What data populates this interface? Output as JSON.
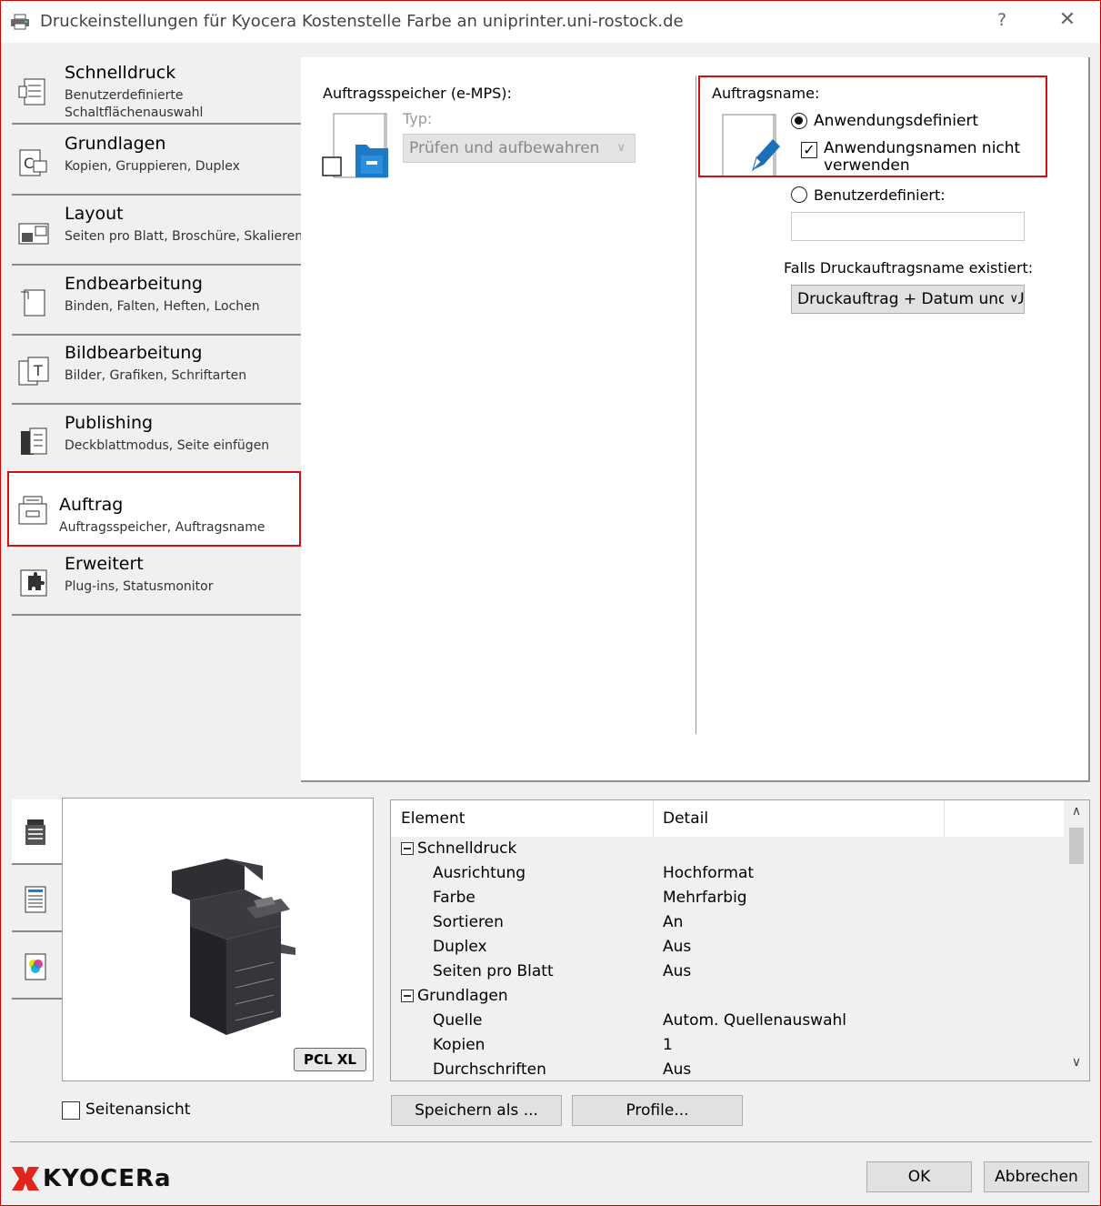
{
  "window": {
    "title": "Druckeinstellungen für Kyocera Kostenstelle Farbe an uniprinter.uni-rostock.de",
    "help": "?",
    "close": "✕"
  },
  "nav": {
    "items": [
      {
        "label": "Schnelldruck",
        "desc1": "Benutzerdefinierte",
        "desc2": "Schaltflächenauswahl"
      },
      {
        "label": "Grundlagen",
        "desc1": "Kopien, Gruppieren, Duplex",
        "desc2": ""
      },
      {
        "label": "Layout",
        "desc1": "Seiten pro Blatt, Broschüre, Skalieren",
        "desc2": ""
      },
      {
        "label": "Endbearbeitung",
        "desc1": "Binden, Falten, Heften, Lochen",
        "desc2": ""
      },
      {
        "label": "Bildbearbeitung",
        "desc1": "Bilder, Grafiken, Schriftarten",
        "desc2": ""
      },
      {
        "label": "Publishing",
        "desc1": "Deckblattmodus, Seite einfügen",
        "desc2": ""
      },
      {
        "label": "Auftrag",
        "desc1": "Auftragsspeicher, Auftragsname",
        "desc2": ""
      },
      {
        "label": "Erweitert",
        "desc1": "Plug-ins, Statusmonitor",
        "desc2": ""
      }
    ],
    "active_index": 6
  },
  "job_storage": {
    "label": "Auftragsspeicher (e-MPS):",
    "type_label": "Typ:",
    "type_value": "Prüfen und aufbewahren"
  },
  "job_name": {
    "label": "Auftragsname:",
    "opt_app_defined": "Anwendungsdefiniert",
    "opt_no_app_name_line1": "Anwendungsnamen nicht",
    "opt_no_app_name_line2": "verwenden",
    "opt_custom": "Benutzerdefiniert:",
    "custom_value": "",
    "exists_label": "Falls Druckauftragsname existiert:",
    "exists_value": "Druckauftrag + Datum und Uhrzeit"
  },
  "preview": {
    "badge": "PCL XL"
  },
  "summary": {
    "col_element": "Element",
    "col_detail": "Detail",
    "rows": [
      {
        "group": true,
        "element": "Schnelldruck",
        "detail": ""
      },
      {
        "group": false,
        "element": "Ausrichtung",
        "detail": "Hochformat"
      },
      {
        "group": false,
        "element": "Farbe",
        "detail": "Mehrfarbig"
      },
      {
        "group": false,
        "element": "Sortieren",
        "detail": "An"
      },
      {
        "group": false,
        "element": "Duplex",
        "detail": "Aus"
      },
      {
        "group": false,
        "element": "Seiten pro Blatt",
        "detail": "Aus"
      },
      {
        "group": true,
        "element": "Grundlagen",
        "detail": ""
      },
      {
        "group": false,
        "element": "Quelle",
        "detail": "Autom. Quellenauswahl"
      },
      {
        "group": false,
        "element": "Kopien",
        "detail": "1"
      },
      {
        "group": false,
        "element": "Durchschriften",
        "detail": "Aus"
      }
    ]
  },
  "footer": {
    "page_view": "Seitenansicht",
    "save_as": "Speichern als ...",
    "profiles": "Profile...",
    "ok": "OK",
    "cancel": "Abbrechen",
    "brand": "KYOCERa",
    "brand_color": "#e1251b"
  }
}
